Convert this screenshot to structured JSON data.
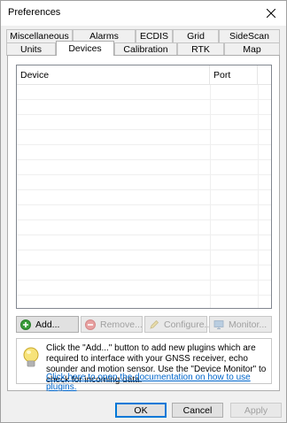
{
  "window": {
    "title": "Preferences"
  },
  "tabs": {
    "row1": [
      {
        "label": "Miscellaneous"
      },
      {
        "label": "Alarms"
      },
      {
        "label": "ECDIS"
      },
      {
        "label": "Grid"
      },
      {
        "label": "SideScan"
      }
    ],
    "row2": [
      {
        "label": "Units"
      },
      {
        "label": "Devices",
        "active": true
      },
      {
        "label": "Calibration"
      },
      {
        "label": "RTK"
      },
      {
        "label": "Map"
      }
    ]
  },
  "device_list": {
    "columns": [
      "Device",
      "Port"
    ],
    "rows": []
  },
  "actions": {
    "add": "Add...",
    "remove": "Remove...",
    "configure": "Configure...",
    "monitor": "Monitor..."
  },
  "info": {
    "text": "Click the \"Add...\" button to add new plugins which are required to interface with your GNSS receiver, echo sounder and motion sensor. Use the \"Device Monitor\" to check for incoming data.",
    "link": "Click here to open the documentation on how to use plugins."
  },
  "buttons": {
    "ok": "OK",
    "cancel": "Cancel",
    "apply": "Apply"
  },
  "icons": {
    "close": "close-icon",
    "add": "add-icon",
    "remove": "remove-icon",
    "configure": "pencil-icon",
    "monitor": "monitor-icon",
    "info": "lightbulb-icon"
  },
  "colors": {
    "link": "#0066cc",
    "default_button": "#0078d7"
  }
}
